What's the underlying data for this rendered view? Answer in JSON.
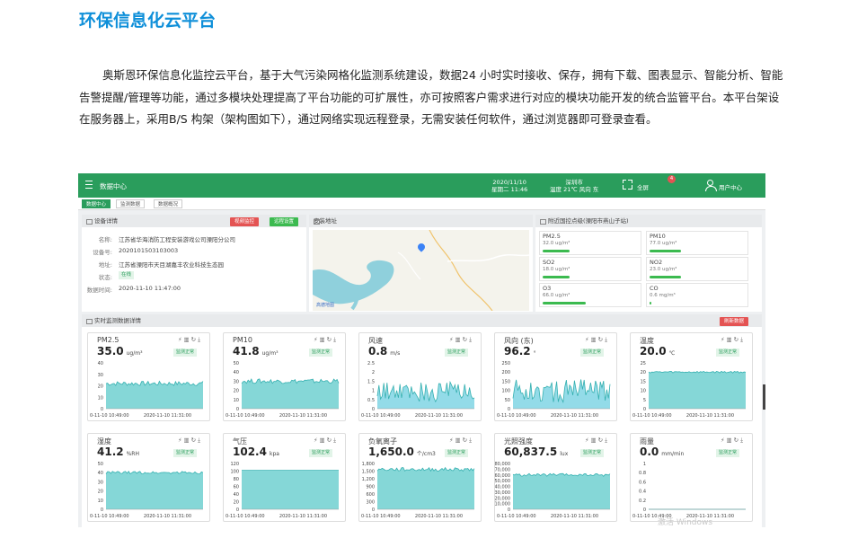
{
  "page": {
    "title": "环保信息化云平台",
    "intro": "奥斯恩环保信息化监控云平台，基于大气污染网格化监测系统建设，数据24 小时实时接收、保存，拥有下载、图表显示、智能分析、智能告警提醒/管理等功能，通过多模块处理提高了平台功能的可扩展性，亦可按照客户需求进行对应的模块功能开发的统合监管平台。本平台架设在服务器上，采用B/S 构架（架构图如下），通过网络实现远程登录，无需安装任何软件，通过浏览器即可登录查看。"
  },
  "app": {
    "nav_title": "数据中心",
    "date": "2020/11/10",
    "time": "星期二 11:46",
    "city": "深圳市",
    "weather": "温度 21℃ 风向 东",
    "fullscreen_label": "全屏",
    "alert_count": "4",
    "user_label": "用户中心",
    "watermark": "激活 Windows"
  },
  "tabs": [
    {
      "label": "数据中心"
    },
    {
      "label": "监测数据"
    },
    {
      "label": "数据概况"
    }
  ],
  "device": {
    "header": "设备详情",
    "video_btn": "视频监控",
    "settings_btn": "远程设置",
    "fields": [
      {
        "label": "名称:",
        "value": "江苏省华海消防工程安装游戏公司溧阳分公司"
      },
      {
        "label": "设备号:",
        "value": "2020101503103003"
      },
      {
        "label": "地址:",
        "value": "江苏省溧阳市天目湖嘉丰农业科技生态园"
      },
      {
        "label": "状态:",
        "value": "在线"
      },
      {
        "label": "数据时间:",
        "value": "2020-11-10 11:47:00"
      }
    ]
  },
  "map": {
    "header": "安装地址",
    "logo": "高德地图"
  },
  "nearby": {
    "header": "附近国控点级(溧阳市燕山子站)",
    "items": [
      {
        "name": "PM2.5",
        "value": "32.0 ug/m³",
        "level": 0.3
      },
      {
        "name": "PM10",
        "value": "77.0 ug/m³",
        "level": 0.35
      },
      {
        "name": "SO2",
        "value": "18.0 ug/m³",
        "level": 0.3
      },
      {
        "name": "NO2",
        "value": "23.0 ug/m³",
        "level": 0.35
      },
      {
        "name": "O3",
        "value": "66.0 ug/m³",
        "level": 0.48
      },
      {
        "name": "CO",
        "value": "0.6 mg/m³",
        "level": 0.02
      }
    ]
  },
  "realtime": {
    "header": "实时监测数据详情",
    "refresh_btn": "刷新数据"
  },
  "cards": [
    {
      "name": "PM2.5",
      "value": "35.0",
      "unit": "ug/m³",
      "badge": "监测正常",
      "ymax": 40,
      "ticks": [
        "40",
        "30",
        "20",
        "10",
        "0"
      ],
      "base": 0.55,
      "amp": 0.05,
      "start": "0-11-10 10:49:00",
      "end": "2020-11-10 11:31:00",
      "color": "#5cc9c9"
    },
    {
      "name": "PM10",
      "value": "41.8",
      "unit": "ug/m³",
      "badge": "监测正常",
      "ymax": 50,
      "ticks": [
        "50",
        "40",
        "30",
        "20",
        "10",
        "0"
      ],
      "base": 0.6,
      "amp": 0.05,
      "start": "0-11-10 10:49:00",
      "end": "2020-11-10 11:31:00",
      "color": "#5cc9c9"
    },
    {
      "name": "风速",
      "value": "0.8",
      "unit": "m/s",
      "badge": "监测正常",
      "ymax": 2.5,
      "ticks": [
        "2.5",
        "2",
        "1.5",
        "1",
        "0.5",
        "0"
      ],
      "base": 0.3,
      "amp": 0.22,
      "start": "0-11-10 10:49:00",
      "end": "2020-11-10 11:31:00",
      "color": "#6fcfe0"
    },
    {
      "name": "风向 (东)",
      "value": "96.2",
      "unit": "°",
      "badge": "监测正常",
      "ymax": 250,
      "ticks": [
        "250",
        "200",
        "150",
        "100",
        "50",
        "0"
      ],
      "base": 0.32,
      "amp": 0.25,
      "start": "0-11-10 10:49:00",
      "end": "2020-11-10 11:31:00",
      "color": "#6fcfe0"
    },
    {
      "name": "温度",
      "value": "20.0",
      "unit": "℃",
      "badge": "监测正常",
      "ymax": 25,
      "ticks": [
        "25",
        "20",
        "15",
        "10",
        "5",
        "0"
      ],
      "base": 0.8,
      "amp": 0.02,
      "start": "0-11-10 10:49:00",
      "end": "2020-11-10 11:31:00",
      "color": "#5cc9c9"
    },
    {
      "name": "湿度",
      "value": "41.2",
      "unit": "%RH",
      "badge": "监测正常",
      "ymax": 50,
      "ticks": [
        "50",
        "40",
        "30",
        "20",
        "10",
        "0"
      ],
      "base": 0.8,
      "amp": 0.03,
      "start": "0-11-10 10:49:00",
      "end": "2020-11-10 11:31:00",
      "color": "#5cc9c9"
    },
    {
      "name": "气压",
      "value": "102.4",
      "unit": "kpa",
      "badge": "监测正常",
      "ymax": 120,
      "ticks": [
        "120",
        "100",
        "80",
        "60",
        "40",
        "20",
        "0"
      ],
      "base": 0.85,
      "amp": 0.0,
      "start": "0-11-10 10:49:00",
      "end": "2020-11-10 11:31:00",
      "color": "#5cc9c9"
    },
    {
      "name": "负氧离子",
      "value": "1,650.0",
      "unit": "个/cm3",
      "badge": "监测正常",
      "ymax": 1800,
      "ticks": [
        "1,800",
        "1,500",
        "1,200",
        "900",
        "600",
        "300",
        "0"
      ],
      "base": 0.87,
      "amp": 0.04,
      "start": "0-11-10 10:49:00",
      "end": "2020-11-10 11:31:00",
      "color": "#5cc9c9"
    },
    {
      "name": "光照强度",
      "value": "60,837.5",
      "unit": "lux",
      "badge": "监测正常",
      "ymax": 80000,
      "ticks": [
        "80,000",
        "70,000",
        "60,000",
        "50,000",
        "40,000",
        "30,000",
        "20,000",
        "10,000",
        "0"
      ],
      "base": 0.75,
      "amp": 0.03,
      "start": "0-11-10 10:49:00",
      "end": "2020-11-10 11:31:00",
      "color": "#5cc9c9"
    },
    {
      "name": "雨量",
      "value": "0.0",
      "unit": "mm/min",
      "badge": "监测正常",
      "ymax": 1,
      "ticks": [
        "1",
        "0.8",
        "0.6",
        "0.4",
        "0.2",
        "0"
      ],
      "base": 0.0,
      "amp": 0.0,
      "start": "0-11-10 10:49:00",
      "end": "2020-11-10 11:31:00",
      "color": "#5cc9c9"
    }
  ]
}
